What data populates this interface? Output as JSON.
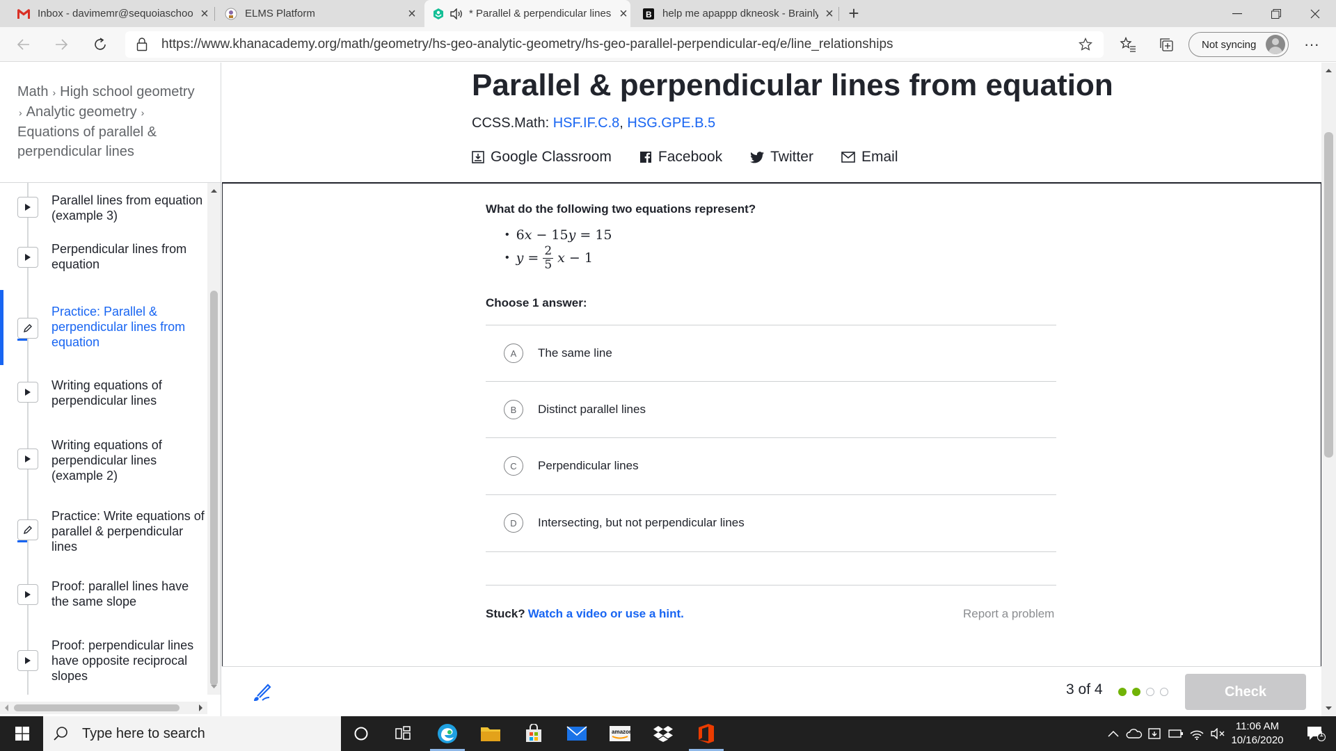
{
  "browser": {
    "tabs": [
      {
        "title": "Inbox - davimemr@sequoiaschools",
        "icon": "gmail-icon"
      },
      {
        "title": "ELMS Platform",
        "icon": "elms-icon"
      },
      {
        "title": "* Parallel & perpendicular lines from equation",
        "icon": "khan-icon",
        "active": true
      },
      {
        "title": "help me apappp dkneosk - Brainly",
        "icon": "brainly-icon"
      }
    ],
    "new_tab_label": "+",
    "url": "https://www.khanacademy.org/math/geometry/hs-geo-analytic-geometry/hs-geo-parallel-perpendicular-eq/e/line_relationships",
    "sync_label": "Not syncing"
  },
  "sidebar": {
    "breadcrumb": [
      "Math",
      "High school geometry",
      "Analytic geometry",
      "Equations of parallel & perpendicular lines"
    ],
    "lessons": [
      {
        "label": "Parallel lines from equation (example 3)",
        "type": "video"
      },
      {
        "label": "Perpendicular lines from equation",
        "type": "video"
      },
      {
        "label": "Practice: Parallel & perpendicular lines from equation",
        "type": "exercise",
        "current": true
      },
      {
        "label": "Writing equations of perpendicular lines",
        "type": "video"
      },
      {
        "label": "Writing equations of perpendicular lines (example 2)",
        "type": "video"
      },
      {
        "label": "Practice: Write equations of parallel & perpendicular lines",
        "type": "exercise"
      },
      {
        "label": "Proof: parallel lines have the same slope",
        "type": "video"
      },
      {
        "label": "Proof: perpendicular lines have opposite reciprocal slopes",
        "type": "video"
      }
    ]
  },
  "header": {
    "title": "Parallel & perpendicular lines from equation",
    "ccss_prefix": "CCSS.Math: ",
    "ccss_link1": "HSF.IF.C.8",
    "ccss_link2": "HSG.GPE.B.5",
    "share": {
      "classroom": "Google Classroom",
      "facebook": "Facebook",
      "twitter": "Twitter",
      "email": "Email"
    }
  },
  "exercise": {
    "question": "What do the following two equations represent?",
    "eq1": {
      "a": "6",
      "b": "15",
      "c": "15"
    },
    "eq2": {
      "num": "2",
      "den": "5",
      "const": "1"
    },
    "choose_label": "Choose 1 answer:",
    "choices": [
      {
        "letter": "A",
        "text": "The same line"
      },
      {
        "letter": "B",
        "text": "Distinct parallel lines"
      },
      {
        "letter": "C",
        "text": "Perpendicular lines"
      },
      {
        "letter": "D",
        "text": "Intersecting, but not perpendicular lines"
      }
    ],
    "stuck_label": "Stuck?",
    "hint_link": "Watch a video or use a hint.",
    "report_link": "Report a problem"
  },
  "footer": {
    "progress_text": "3 of 4",
    "progress": {
      "completed": 2,
      "total": 4
    },
    "check_label": "Check",
    "colors": {
      "done": "#71b307",
      "todo": "#babec2"
    }
  },
  "taskbar": {
    "search_placeholder": "Type here to search",
    "time": "11:06 AM",
    "date": "10/16/2020",
    "notification_count": "1"
  }
}
